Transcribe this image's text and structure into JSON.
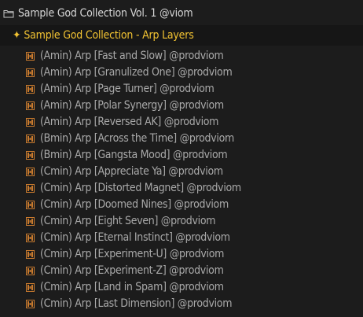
{
  "folder": {
    "label": "Sample God Collection Vol. 1 @viom",
    "icon": "folder-icon"
  },
  "subfolder": {
    "label": "Sample God Collection - Arp Layers",
    "icon": "sparkle-icon",
    "icon_glyph": "✦",
    "color": "#f1c232"
  },
  "file_icon": {
    "name": "audio-file-icon",
    "color": "#c87a2e"
  },
  "files": [
    "(Amin) Arp [Fast and Slow] @prodviom",
    "(Amin) Arp [Granulized One] @prodviom",
    "(Amin) Arp [Page Turner] @prodviom",
    "(Amin) Arp [Polar Synergy] @prodviom",
    "(Amin) Arp [Reversed AK] @prodviom",
    "(Bmin) Arp [Across the Time] @prodviom",
    "(Bmin) Arp [Gangsta Mood] @prodviom",
    "(Cmin) Arp [Appreciate Ya] @prodviom",
    "(Cmin) Arp [Distorted Magnet] @prodviom",
    "(Cmin) Arp [Doomed Nines] @prodviom",
    "(Cmin) Arp [Eight Seven] @prodviom",
    "(Cmin) Arp [Eternal Instinct] @prodviom",
    "(Cmin) Arp [Experiment-U] @prodviom",
    "(Cmin) Arp [Experiment-Z] @prodviom",
    "(Cmin) Arp [Land in Spam] @prodviom",
    "(Cmin) Arp [Last Dimension] @prodviom"
  ]
}
